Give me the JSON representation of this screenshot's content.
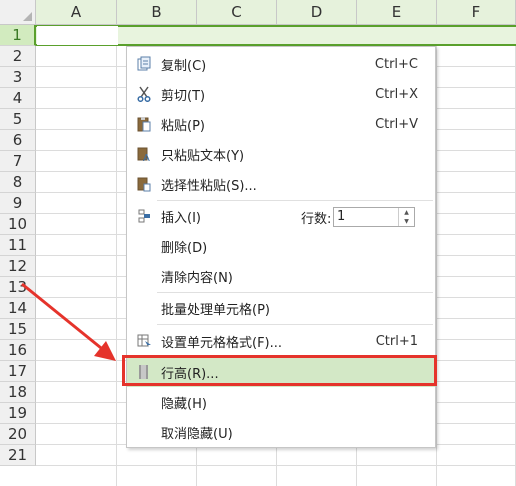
{
  "columns": [
    "A",
    "B",
    "C",
    "D",
    "E",
    "F"
  ],
  "rows": [
    "1",
    "2",
    "3",
    "4",
    "5",
    "6",
    "7",
    "8",
    "9",
    "10",
    "11",
    "12",
    "13",
    "14",
    "15",
    "16",
    "17",
    "18",
    "19",
    "20",
    "21"
  ],
  "selected_row": "1",
  "menu": {
    "copy": {
      "label": "复制(C)",
      "shortcut": "Ctrl+C",
      "icon": "copy-icon"
    },
    "cut": {
      "label": "剪切(T)",
      "shortcut": "Ctrl+X",
      "icon": "scissors-icon"
    },
    "paste": {
      "label": "粘贴(P)",
      "shortcut": "Ctrl+V",
      "icon": "paste-icon"
    },
    "paste_text": {
      "label": "只粘贴文本(Y)",
      "icon": "paste-text-icon"
    },
    "paste_special": {
      "label": "选择性粘贴(S)...",
      "icon": "paste-special-icon"
    },
    "insert": {
      "label": "插入(I)",
      "count_label": "行数:",
      "count_value": "1",
      "icon": "insert-row-icon"
    },
    "delete": {
      "label": "删除(D)"
    },
    "clear": {
      "label": "清除内容(N)"
    },
    "batch": {
      "label": "批量处理单元格(P)"
    },
    "format_cells": {
      "label": "设置单元格格式(F)...",
      "shortcut": "Ctrl+1",
      "icon": "format-cells-icon"
    },
    "row_height": {
      "label": "行高(R)...",
      "icon": "row-height-icon"
    },
    "hide": {
      "label": "隐藏(H)"
    },
    "unhide": {
      "label": "取消隐藏(U)"
    }
  },
  "colors": {
    "highlight": "#d3e8c6",
    "annotation_red": "#e5332b",
    "selection_green": "#5aa02c"
  }
}
